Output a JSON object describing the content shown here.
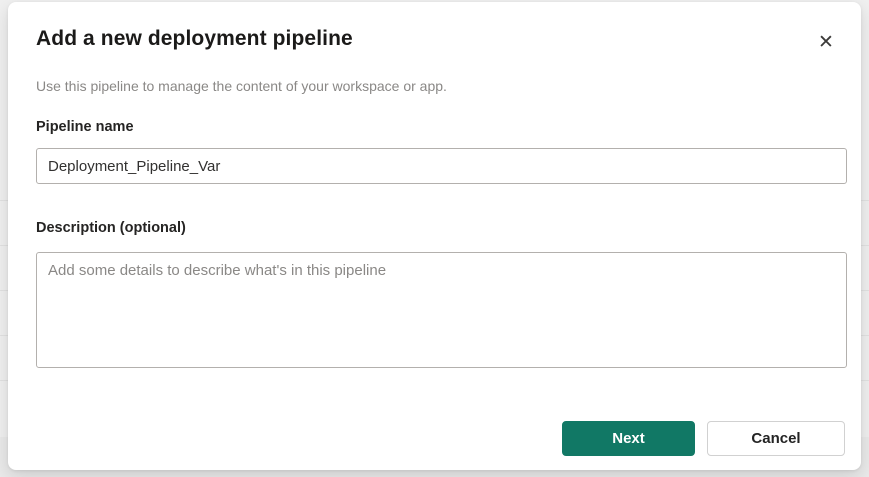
{
  "dialog": {
    "title": "Add a new deployment pipeline",
    "subtitle": "Use this pipeline to manage the content of your workspace or app.",
    "icons": {
      "close": "✕"
    },
    "fields": {
      "pipeline_name": {
        "label": "Pipeline name",
        "value": "Deployment_Pipeline_Var"
      },
      "description": {
        "label": "Description (optional)",
        "placeholder": "Add some details to describe what's in this pipeline"
      }
    },
    "buttons": {
      "next": "Next",
      "cancel": "Cancel"
    },
    "colors": {
      "primary_button_bg": "#117865",
      "primary_button_text": "#ffffff",
      "cancel_button_border": "#d1d1d1",
      "input_border": "#b3b0ad",
      "subtitle_text": "#8a8886",
      "backdrop": "#f0f0f0"
    }
  }
}
